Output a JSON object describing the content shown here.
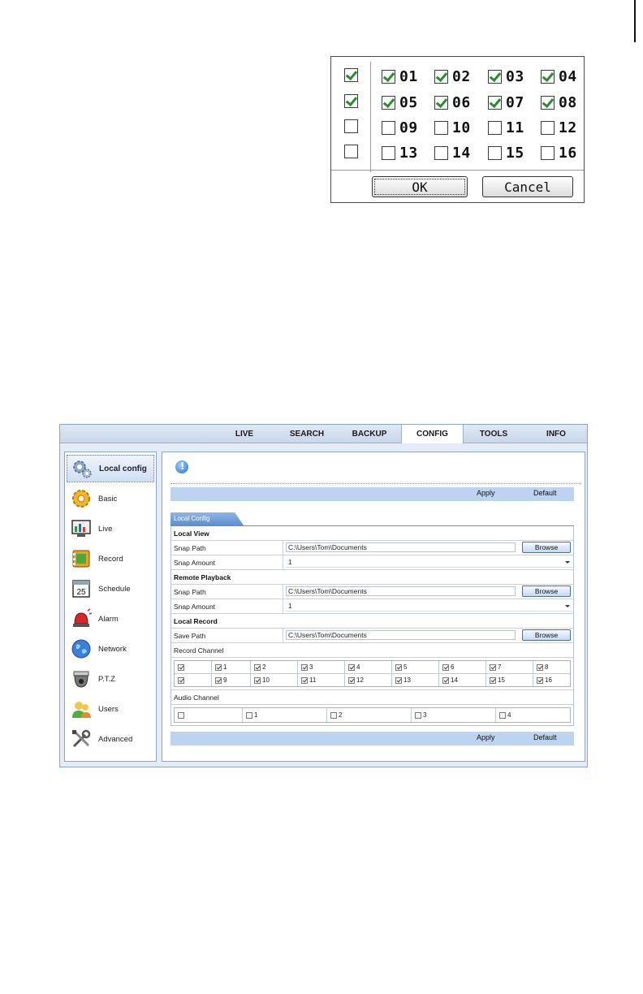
{
  "channel_dialog": {
    "rows": [
      {
        "all_checked": true,
        "channels": [
          {
            "num": "01",
            "checked": true
          },
          {
            "num": "02",
            "checked": true
          },
          {
            "num": "03",
            "checked": true
          },
          {
            "num": "04",
            "checked": true
          }
        ]
      },
      {
        "all_checked": true,
        "channels": [
          {
            "num": "05",
            "checked": true
          },
          {
            "num": "06",
            "checked": true
          },
          {
            "num": "07",
            "checked": true
          },
          {
            "num": "08",
            "checked": true
          }
        ]
      },
      {
        "all_checked": false,
        "channels": [
          {
            "num": "09",
            "checked": false
          },
          {
            "num": "10",
            "checked": false
          },
          {
            "num": "11",
            "checked": false
          },
          {
            "num": "12",
            "checked": false
          }
        ]
      },
      {
        "all_checked": false,
        "channels": [
          {
            "num": "13",
            "checked": false
          },
          {
            "num": "14",
            "checked": false
          },
          {
            "num": "15",
            "checked": false
          },
          {
            "num": "16",
            "checked": false
          }
        ]
      }
    ],
    "ok_label": "OK",
    "cancel_label": "Cancel",
    "check_color": "#2d8a2d"
  },
  "client": {
    "nav_tabs": [
      "LIVE",
      "SEARCH",
      "BACKUP",
      "CONFIG",
      "TOOLS",
      "INFO"
    ],
    "active_tab": "CONFIG",
    "sidebar": [
      {
        "label": "Local config",
        "icon": "gears-icon",
        "active": true
      },
      {
        "label": "Basic",
        "icon": "gear-icon",
        "active": false
      },
      {
        "label": "Live",
        "icon": "monitor-icon",
        "active": false
      },
      {
        "label": "Record",
        "icon": "film-icon",
        "active": false
      },
      {
        "label": "Schedule",
        "icon": "calendar-icon",
        "active": false
      },
      {
        "label": "Alarm",
        "icon": "siren-icon",
        "active": false
      },
      {
        "label": "Network",
        "icon": "globe-icon",
        "active": false
      },
      {
        "label": "P.T.Z",
        "icon": "dome-camera-icon",
        "active": false
      },
      {
        "label": "Users",
        "icon": "users-icon",
        "active": false
      },
      {
        "label": "Advanced",
        "icon": "tools-icon",
        "active": false
      }
    ],
    "calendar_day": "25",
    "apply_label": "Apply",
    "default_label": "Default",
    "tab_title": "Local Config",
    "browse_label": "Browse",
    "local_view": {
      "heading": "Local View",
      "snap_path_label": "Snap Path",
      "snap_path": "C:\\Users\\Tom\\Documents",
      "snap_amount_label": "Snap Amount",
      "snap_amount": "1"
    },
    "remote_playback": {
      "heading": "Remote Playback",
      "snap_path_label": "Snap Path",
      "snap_path": "C:\\Users\\Tom\\Documents",
      "snap_amount_label": "Snap Amount",
      "snap_amount": "1"
    },
    "local_record": {
      "heading": "Local Record",
      "save_path_label": "Save Path",
      "save_path": "C:\\Users\\Tom\\Documents",
      "record_channel_label": "Record Channel",
      "record_rows": [
        [
          {
            "label": "",
            "checked": true
          },
          {
            "label": "1",
            "checked": true
          },
          {
            "label": "2",
            "checked": true
          },
          {
            "label": "3",
            "checked": true
          },
          {
            "label": "4",
            "checked": true
          },
          {
            "label": "5",
            "checked": true
          },
          {
            "label": "6",
            "checked": true
          },
          {
            "label": "7",
            "checked": true
          },
          {
            "label": "8",
            "checked": true
          }
        ],
        [
          {
            "label": "",
            "checked": true
          },
          {
            "label": "9",
            "checked": true
          },
          {
            "label": "10",
            "checked": true
          },
          {
            "label": "11",
            "checked": true
          },
          {
            "label": "12",
            "checked": true
          },
          {
            "label": "13",
            "checked": true
          },
          {
            "label": "14",
            "checked": true
          },
          {
            "label": "15",
            "checked": true
          },
          {
            "label": "16",
            "checked": true
          }
        ]
      ],
      "audio_channel_label": "Audio Channel",
      "audio_row": [
        {
          "label": "",
          "checked": false
        },
        {
          "label": "1",
          "checked": false
        },
        {
          "label": "2",
          "checked": false
        },
        {
          "label": "3",
          "checked": false
        },
        {
          "label": "4",
          "checked": false
        }
      ]
    },
    "colors": {
      "accent": "#5c8fd0",
      "bar": "#bcd4f0",
      "border": "#8fa4c0"
    }
  }
}
